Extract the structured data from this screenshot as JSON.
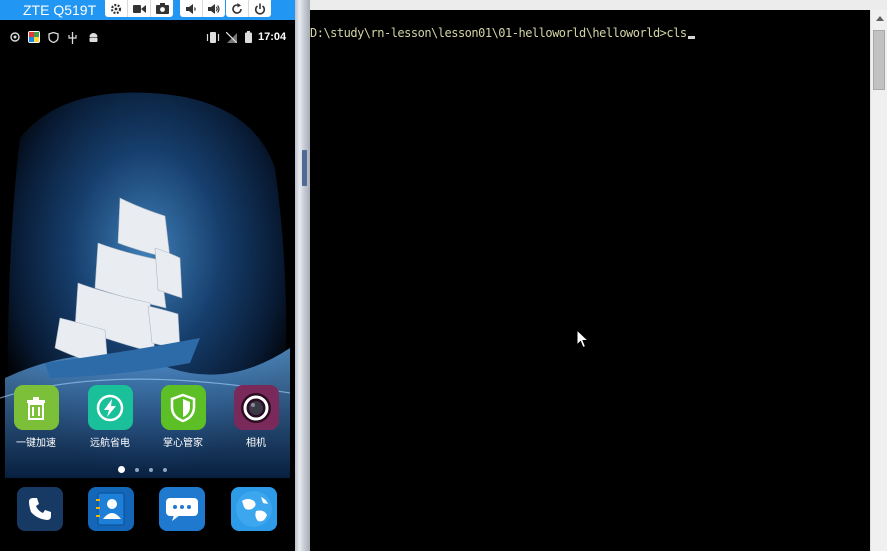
{
  "phone": {
    "device_name": "ZTE Q519T",
    "clock": "17:04",
    "apps": [
      {
        "label": "一键加速",
        "icon": "trash-can-icon",
        "color": "#7cc03a"
      },
      {
        "label": "远航省电",
        "icon": "lightning-icon",
        "color": "#19c09a"
      },
      {
        "label": "掌心管家",
        "icon": "shield-icon",
        "color": "#5cbf26"
      },
      {
        "label": "相机",
        "icon": "camera-lens-icon",
        "color": "#7a2a5a"
      }
    ],
    "dock": [
      {
        "icon": "phone-icon"
      },
      {
        "icon": "contacts-icon"
      },
      {
        "icon": "messages-icon"
      },
      {
        "icon": "browser-globe-icon"
      }
    ],
    "page_count": 4,
    "active_page": 1
  },
  "terminal": {
    "prompt": "D:\\study\\rn-lesson\\lesson01\\01-helloworld\\helloworld>",
    "command": "cls"
  }
}
